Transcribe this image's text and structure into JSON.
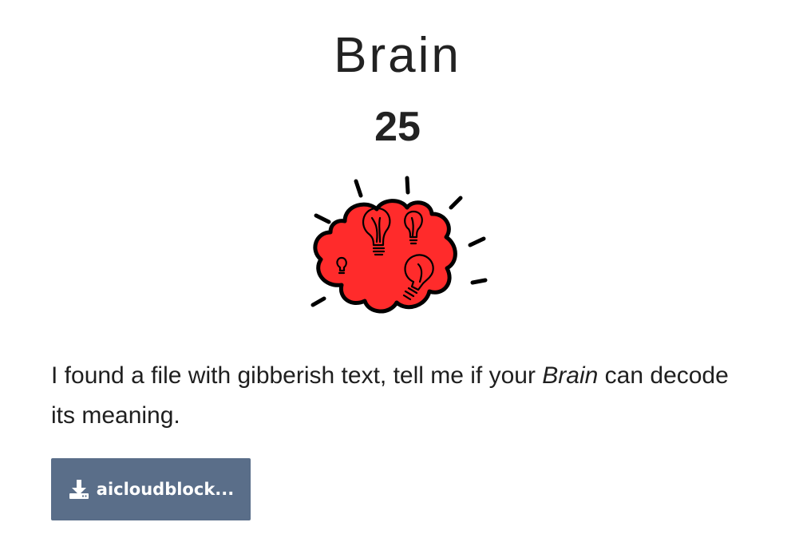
{
  "challenge": {
    "title": "Brain",
    "points": "25",
    "description": {
      "before": "I found a file with gibberish text, tell me if your ",
      "emphasis": "Brain",
      "after": " can decode its meaning."
    },
    "illustration": "exploding-brain-lightbulbs-icon",
    "download": {
      "label": "aicloudblock...",
      "icon": "download-icon"
    }
  },
  "colors": {
    "brain_fill": "#ff2b2b",
    "button_bg": "#5a6e89",
    "button_text": "#ffffff"
  }
}
